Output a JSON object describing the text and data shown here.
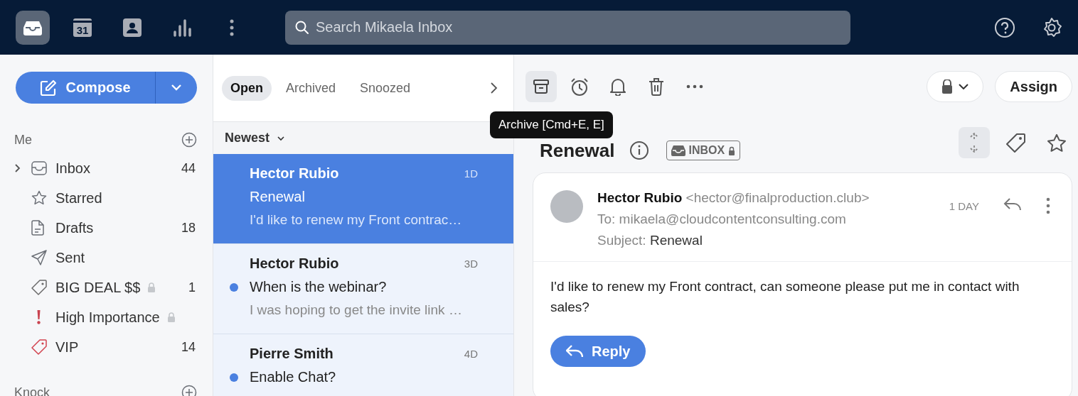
{
  "app_bar": {
    "nav": [
      {
        "kind": "inbox",
        "selected": true
      },
      {
        "kind": "calendar",
        "label": "31",
        "selected": false
      },
      {
        "kind": "contacts",
        "selected": false
      },
      {
        "kind": "analytics",
        "selected": false
      },
      {
        "kind": "more",
        "selected": false
      }
    ],
    "search": {
      "placeholder": "Search Mikaela Inbox"
    }
  },
  "sidebar": {
    "compose": "Compose",
    "sections": [
      {
        "title": "Me",
        "items": [
          {
            "kind": "inbox",
            "label": "Inbox",
            "count": "44",
            "locked": false,
            "expanded": false
          },
          {
            "kind": "star",
            "label": "Starred",
            "locked": false
          },
          {
            "kind": "draft",
            "label": "Drafts",
            "count": "18",
            "locked": false
          },
          {
            "kind": "sent",
            "label": "Sent",
            "locked": false
          },
          {
            "kind": "tag",
            "label": "BIG DEAL $$",
            "count": "1",
            "locked": true,
            "color": "#6b6b6b"
          },
          {
            "kind": "important",
            "label": "High Importance",
            "locked": true
          },
          {
            "kind": "tag",
            "label": "VIP",
            "count": "14",
            "locked": false,
            "color": "#d2434f"
          }
        ]
      },
      {
        "title": "Knock"
      }
    ]
  },
  "list": {
    "tabs": [
      {
        "label": "Open",
        "selected": true
      },
      {
        "label": "Archived",
        "selected": false
      },
      {
        "label": "Snoozed",
        "selected": false
      }
    ],
    "sort": "Newest",
    "messages": [
      {
        "sender": "Hector Rubio",
        "age": "1D",
        "subject": "Renewal",
        "preview": "I'd like to renew my Front contrac…",
        "selected": true,
        "unread": false
      },
      {
        "sender": "Hector Rubio",
        "age": "3D",
        "subject": "When is the webinar?",
        "preview": "I was hoping to get the invite link …",
        "selected": false,
        "unread": true
      },
      {
        "sender": "Pierre Smith",
        "age": "4D",
        "subject": "Enable Chat?",
        "selected": false,
        "unread": true
      }
    ]
  },
  "reader": {
    "tooltip": "Archive [Cmd+E, E]",
    "assign": "Assign",
    "title": "Renewal",
    "tag": "INBOX",
    "message": {
      "sender": "Hector Rubio",
      "address": "<hector@finalproduction.club>",
      "age": "1 DAY",
      "to_label": "To:",
      "to": "mikaela@cloudcontentconsulting.com",
      "subject_label": "Subject:",
      "subject": "Renewal",
      "body": "I'd like to renew my Front contract, can someone please put me in contact with sales?",
      "reply": "Reply"
    }
  }
}
